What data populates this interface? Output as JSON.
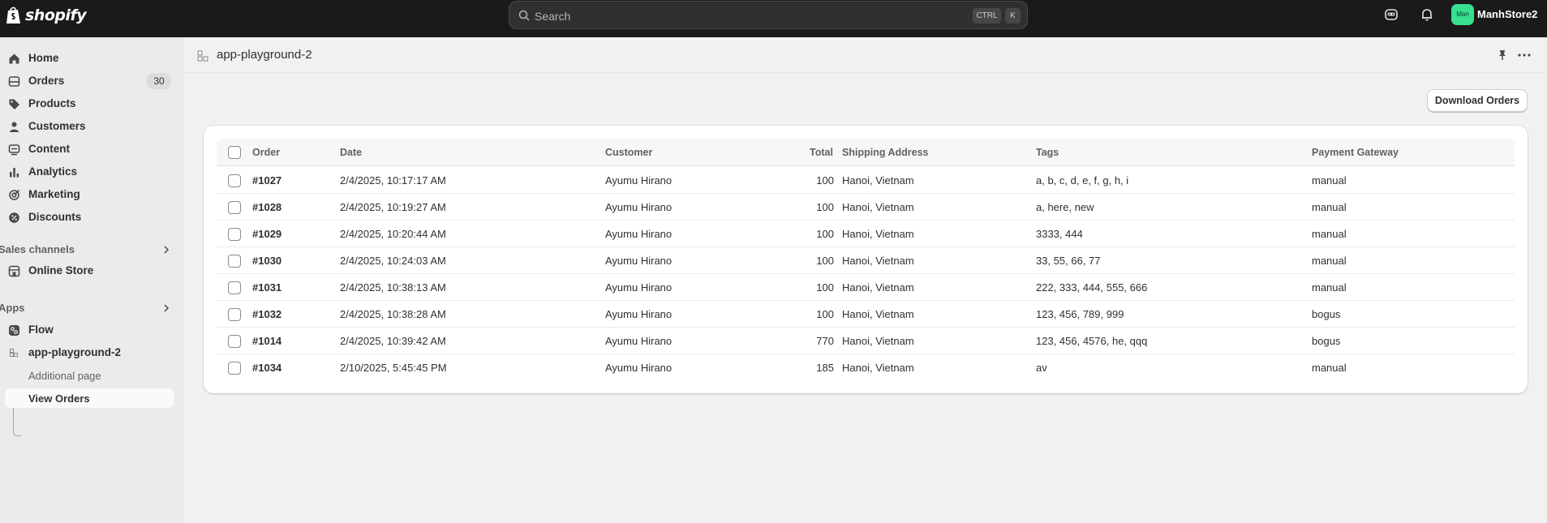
{
  "topbar": {
    "brand": "shopify",
    "search_placeholder": "Search",
    "shortcut_ctrl": "CTRL",
    "shortcut_k": "K",
    "avatar_initials": "Man",
    "store_name": "ManhStore2"
  },
  "sidebar": {
    "items": [
      {
        "label": "Home",
        "icon": "home-icon"
      },
      {
        "label": "Orders",
        "icon": "orders-icon",
        "badge": "30"
      },
      {
        "label": "Products",
        "icon": "tag-icon"
      },
      {
        "label": "Customers",
        "icon": "person-icon"
      },
      {
        "label": "Content",
        "icon": "content-icon"
      },
      {
        "label": "Analytics",
        "icon": "bar-chart-icon"
      },
      {
        "label": "Marketing",
        "icon": "target-icon"
      },
      {
        "label": "Discounts",
        "icon": "discount-icon"
      }
    ],
    "sales_channels_label": "Sales channels",
    "online_store_label": "Online Store",
    "apps_label": "Apps",
    "flow_label": "Flow",
    "app_label": "app-playground-2",
    "additional_page_label": "Additional page",
    "view_orders_label": "View Orders"
  },
  "page": {
    "title": "app-playground-2",
    "download_button": "Download Orders"
  },
  "table": {
    "headers": [
      "Order",
      "Date",
      "Customer",
      "Total",
      "Shipping Address",
      "Tags",
      "Payment Gateway"
    ],
    "rows": [
      {
        "order": "#1027",
        "date": "2/4/2025, 10:17:17 AM",
        "customer": "Ayumu Hirano",
        "total": "100",
        "address": "Hanoi, Vietnam",
        "tags": "a, b, c, d, e, f, g, h, i",
        "gateway": "manual"
      },
      {
        "order": "#1028",
        "date": "2/4/2025, 10:19:27 AM",
        "customer": "Ayumu Hirano",
        "total": "100",
        "address": "Hanoi, Vietnam",
        "tags": "a, here, new",
        "gateway": "manual"
      },
      {
        "order": "#1029",
        "date": "2/4/2025, 10:20:44 AM",
        "customer": "Ayumu Hirano",
        "total": "100",
        "address": "Hanoi, Vietnam",
        "tags": "3333, 444",
        "gateway": "manual"
      },
      {
        "order": "#1030",
        "date": "2/4/2025, 10:24:03 AM",
        "customer": "Ayumu Hirano",
        "total": "100",
        "address": "Hanoi, Vietnam",
        "tags": "33, 55, 66, 77",
        "gateway": "manual"
      },
      {
        "order": "#1031",
        "date": "2/4/2025, 10:38:13 AM",
        "customer": "Ayumu Hirano",
        "total": "100",
        "address": "Hanoi, Vietnam",
        "tags": "222, 333, 444, 555, 666",
        "gateway": "manual"
      },
      {
        "order": "#1032",
        "date": "2/4/2025, 10:38:28 AM",
        "customer": "Ayumu Hirano",
        "total": "100",
        "address": "Hanoi, Vietnam",
        "tags": "123, 456, 789, 999",
        "gateway": "bogus"
      },
      {
        "order": "#1014",
        "date": "2/4/2025, 10:39:42 AM",
        "customer": "Ayumu Hirano",
        "total": "770",
        "address": "Hanoi, Vietnam",
        "tags": "123, 456, 4576, he, qqq",
        "gateway": "bogus"
      },
      {
        "order": "#1034",
        "date": "2/10/2025, 5:45:45 PM",
        "customer": "Ayumu Hirano",
        "total": "185",
        "address": "Hanoi, Vietnam",
        "tags": "av",
        "gateway": "manual"
      }
    ]
  }
}
